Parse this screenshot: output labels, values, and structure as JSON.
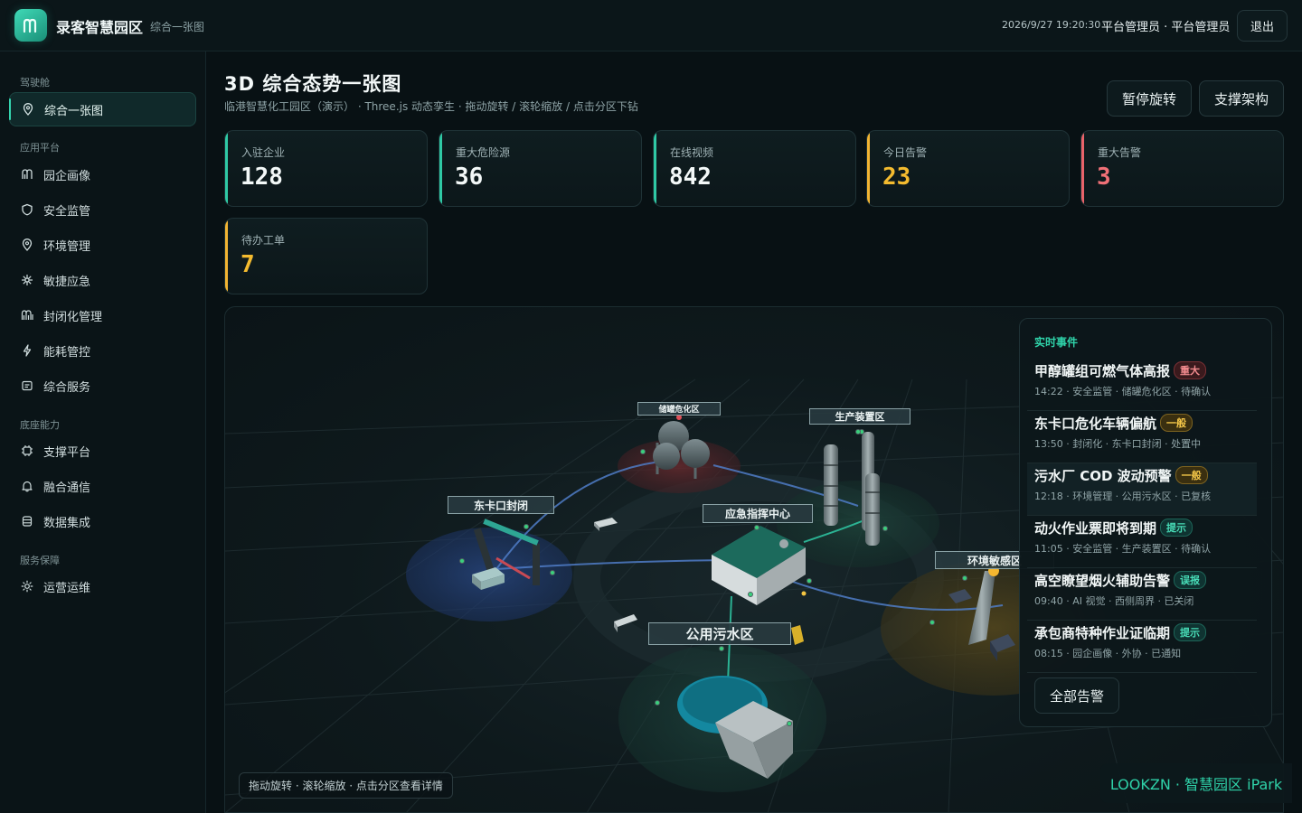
{
  "header": {
    "brand": "录客智慧园区",
    "subtitle": "综合一张图",
    "datetime": "2026/9/27 19:20:30",
    "user": "平台管理员 · 平台管理员",
    "logout_label": "退出"
  },
  "sidebar": {
    "groups": [
      {
        "label": "驾驶舱",
        "items": [
          {
            "label": "综合一张图",
            "icon": "map-pin-icon",
            "active": true
          }
        ]
      },
      {
        "label": "应用平台",
        "items": [
          {
            "label": "园企画像",
            "icon": "building-icon"
          },
          {
            "label": "安全监管",
            "icon": "shield-icon"
          },
          {
            "label": "环境管理",
            "icon": "location-icon"
          },
          {
            "label": "敏捷应急",
            "icon": "alert-burst-icon"
          },
          {
            "label": "封闭化管理",
            "icon": "gate-icon"
          },
          {
            "label": "能耗管控",
            "icon": "lightning-icon"
          },
          {
            "label": "综合服务",
            "icon": "service-icon"
          }
        ]
      },
      {
        "label": "底座能力",
        "items": [
          {
            "label": "支撑平台",
            "icon": "chip-icon"
          },
          {
            "label": "融合通信",
            "icon": "bell-icon"
          },
          {
            "label": "数据集成",
            "icon": "database-icon"
          }
        ]
      },
      {
        "label": "服务保障",
        "items": [
          {
            "label": "运营运维",
            "icon": "gear-icon"
          }
        ]
      }
    ]
  },
  "main": {
    "title": "3D 综合态势一张图",
    "subtitle": "临港智慧化工园区（演示） · Three.js 动态孪生 · 拖动旋转 / 滚轮缩放 / 点击分区下钻",
    "pause_label": "暂停旋转",
    "arch_label": "支撑架构"
  },
  "kpis": [
    {
      "label": "入驻企业",
      "value": "128",
      "tone": "teal"
    },
    {
      "label": "重大危险源",
      "value": "36",
      "tone": "teal"
    },
    {
      "label": "在线视频",
      "value": "842",
      "tone": "teal"
    },
    {
      "label": "今日告警",
      "value": "23",
      "tone": "amber"
    },
    {
      "label": "重大告警",
      "value": "3",
      "tone": "red"
    },
    {
      "label": "待办工单",
      "value": "7",
      "tone": "amber"
    }
  ],
  "scene": {
    "zones": {
      "storage": "储罐危化区",
      "production": "生产装置区",
      "east_gate": "东卡口封闭",
      "command": "应急指挥中心",
      "environment": "环境敏感区",
      "sewage": "公用污水区"
    },
    "hint": "拖动旋转 · 滚轮缩放 · 点击分区查看详情"
  },
  "events": {
    "title": "实时事件",
    "items": [
      {
        "title": "甲醇罐组可燃气体高报",
        "level": "重大",
        "level_class": "major",
        "meta": "14:22 · 安全监管 · 储罐危化区 · 待确认"
      },
      {
        "title": "东卡口危化车辆偏航",
        "level": "一般",
        "level_class": "general",
        "meta": "13:50 · 封闭化 · 东卡口封闭 · 处置中"
      },
      {
        "title": "污水厂 COD 波动预警",
        "level": "一般",
        "level_class": "general",
        "meta": "12:18 · 环境管理 · 公用污水区 · 已复核"
      },
      {
        "title": "动火作业票即将到期",
        "level": "提示",
        "level_class": "hint",
        "meta": "11:05 · 安全监管 · 生产装置区 · 待确认"
      },
      {
        "title": "高空瞭望烟火辅助告警",
        "level": "误报",
        "level_class": "hint",
        "meta": "09:40 · AI 视觉 · 西侧周界 · 已关闭"
      },
      {
        "title": "承包商特种作业证临期",
        "level": "提示",
        "level_class": "hint",
        "meta": "08:15 · 园企画像 · 外协 · 已通知"
      }
    ],
    "all_label": "全部告警"
  },
  "watermark": "LOOKZN · 智慧园区 iPark",
  "colors": {
    "accent": "#2fc9a5",
    "warning": "#f2b432",
    "danger": "#e9636a"
  }
}
